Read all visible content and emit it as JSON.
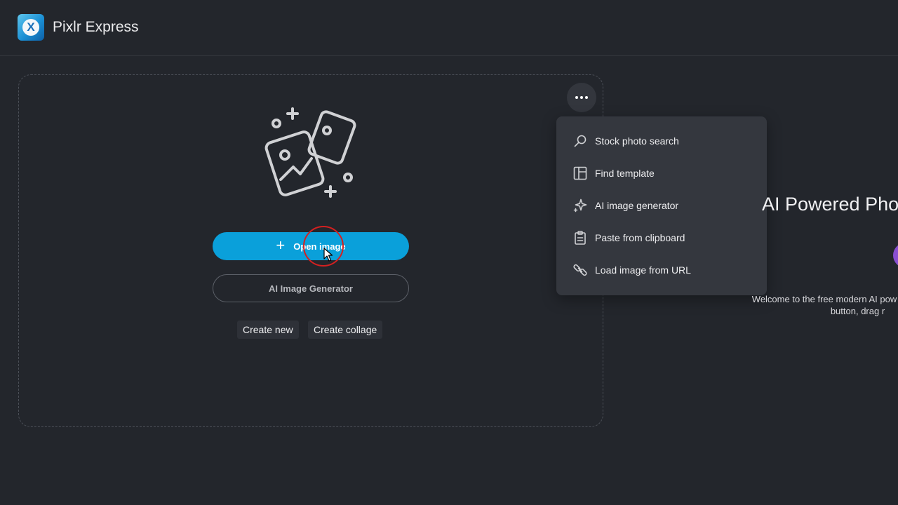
{
  "app": {
    "title": "Pixlr Express",
    "logo_letter": "X"
  },
  "upload": {
    "open_image_label": "Open image",
    "ai_generator_label": "AI Image Generator",
    "create_new_label": "Create new",
    "create_collage_label": "Create collage"
  },
  "more_menu": {
    "items": [
      {
        "label": "Stock photo search",
        "icon": "search-icon"
      },
      {
        "label": "Find template",
        "icon": "template-icon"
      },
      {
        "label": "AI image generator",
        "icon": "sparkle-icon"
      },
      {
        "label": "Paste from clipboard",
        "icon": "clipboard-icon"
      },
      {
        "label": "Load image from URL",
        "icon": "link-icon"
      }
    ]
  },
  "hero": {
    "heading": "AI Powered Pho",
    "welcome_line1": "Welcome to the free modern AI pow",
    "welcome_line2": "button, drag r"
  },
  "colors": {
    "background": "#23262c",
    "accent": "#0aa0da",
    "menu_bg": "#34373e",
    "cursor_highlight": "#d42020"
  }
}
